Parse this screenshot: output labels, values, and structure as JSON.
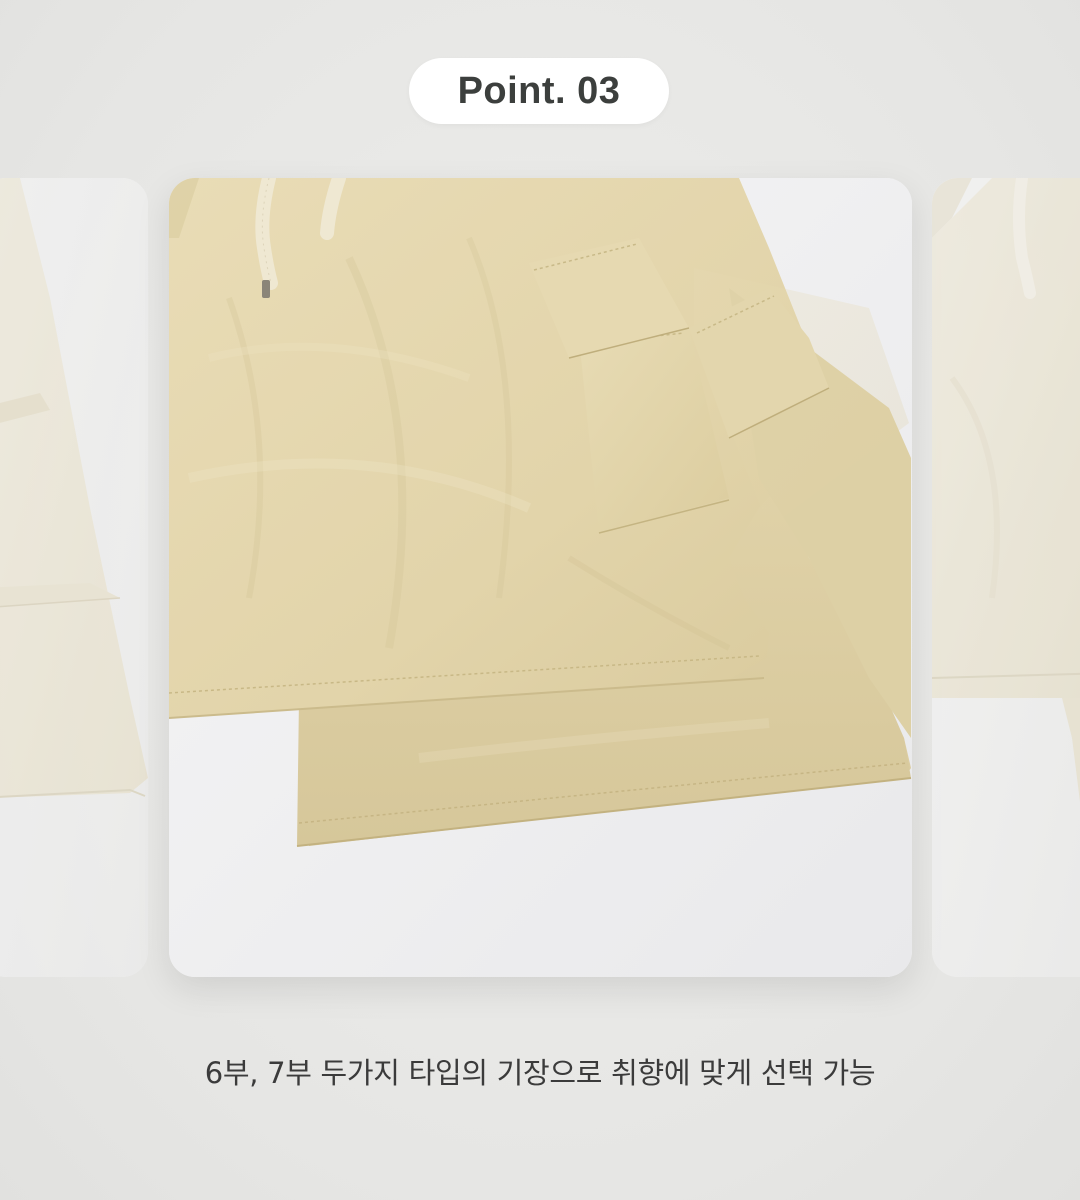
{
  "header": {
    "point_label": "Point. 03"
  },
  "carousel": {
    "slides": [
      {
        "position": "previous",
        "image_subject": "beige cargo skirt"
      },
      {
        "position": "current",
        "image_subject": "beige cargo skirt"
      },
      {
        "position": "next",
        "image_subject": "beige cargo skirt"
      }
    ]
  },
  "caption": {
    "text": "6부, 7부 두가지 타입의 기장으로 취향에 맞게 선택 가능"
  },
  "colors": {
    "background": "#e9e9e7",
    "pill_background": "#ffffff",
    "fabric_main": "#e3d6ad",
    "fabric_light": "#efe9d6",
    "text_dark": "#3c3f3d"
  }
}
